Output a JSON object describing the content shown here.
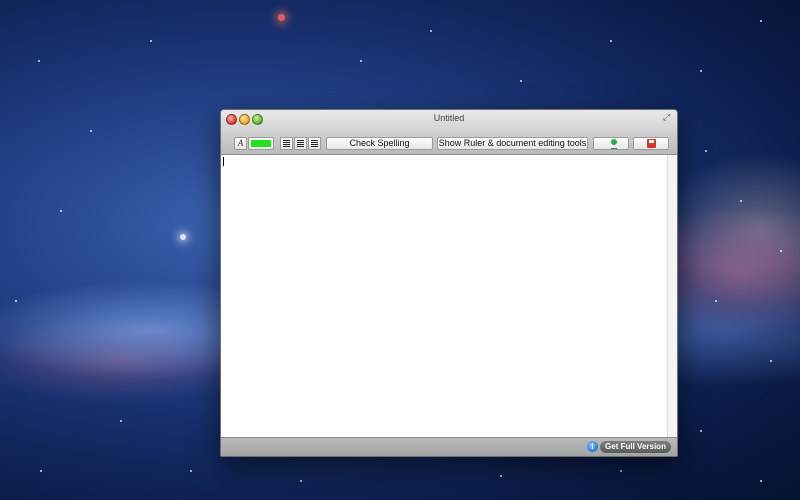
{
  "window": {
    "title": "Untitled"
  },
  "toolbar": {
    "font_button_label": "A",
    "text_color": "#22e222",
    "check_spelling_label": "Check Spelling",
    "show_ruler_label": "Show Ruler & document editing tools"
  },
  "statusbar": {
    "info_icon_glyph": "i",
    "get_full_version_label": "Get Full Version"
  },
  "colors": {
    "accent_green": "#22e222",
    "info_blue": "#2b7fe0"
  },
  "icons": [
    "close-icon",
    "minimize-icon",
    "zoom-icon",
    "fullscreen-icon",
    "align-left-icon",
    "align-center-icon",
    "align-right-icon",
    "find-icon",
    "save-icon",
    "info-icon"
  ]
}
